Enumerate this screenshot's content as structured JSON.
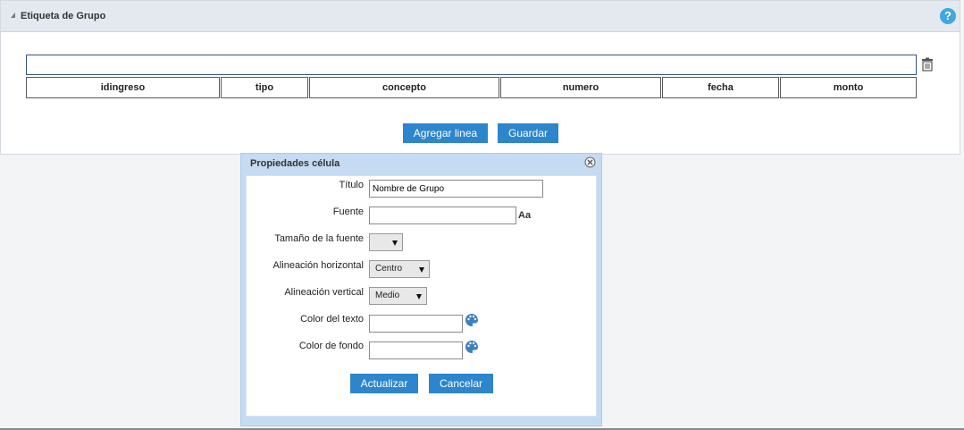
{
  "panel": {
    "title": "Etiqueta de Grupo",
    "help_label": "?"
  },
  "table": {
    "columns": [
      "idingreso",
      "tipo",
      "concepto",
      "numero",
      "fecha",
      "monto"
    ]
  },
  "actions": {
    "add_line": "Agregar linea",
    "save": "Guardar"
  },
  "dialog": {
    "title": "Propiedades célula",
    "fields": {
      "titulo_label": "Título",
      "titulo_value": "Nombre de Grupo",
      "fuente_label": "Fuente",
      "fuente_value": "",
      "tamano_label": "Tamaño de la fuente",
      "tamano_value": "",
      "alin_h_label": "Alineación horizontal",
      "alin_h_value": "Centro",
      "alin_v_label": "Alineación vertical",
      "alin_v_value": "Medio",
      "color_texto_label": "Color del texto",
      "color_texto_value": "",
      "color_fondo_label": "Color de fondo",
      "color_fondo_value": "",
      "font_icon_text": "Aa"
    },
    "update": "Actualizar",
    "cancel": "Cancelar"
  },
  "colors": {
    "primary_button": "#2d85cc",
    "help": "#41a7e2",
    "dialog_bg": "#c5dbf2"
  },
  "icons": [
    "collapse-triangle-icon",
    "help-icon",
    "trash-icon",
    "close-icon",
    "font-icon",
    "palette-icon"
  ]
}
